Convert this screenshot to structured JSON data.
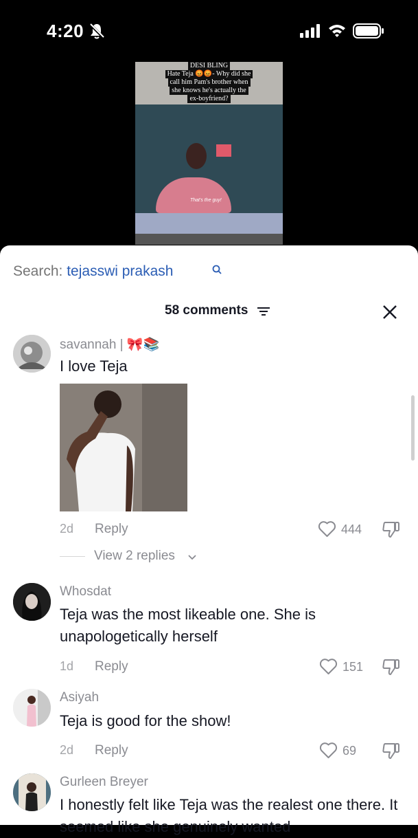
{
  "status": {
    "time": "4:20"
  },
  "video": {
    "caption_lines": [
      "DESI BLING",
      "Hate Teja 😡😡- Why did she",
      "call him Pam's brother when",
      "she knows he's actually the",
      "ex-boyfriend?"
    ],
    "subtitle": "That's the guy!"
  },
  "search": {
    "label": "Search: ",
    "query": "tejasswi prakash"
  },
  "header": {
    "comments_count": "58 comments"
  },
  "comments": [
    {
      "username": "savannah | 🎀📚",
      "text": "I love Teja",
      "time": "2d",
      "reply": "Reply",
      "likes": "444",
      "view_replies": "View 2 replies"
    },
    {
      "username": "Whosdat",
      "text": "Teja was the most likeable one. She is unapologetically herself",
      "time": "1d",
      "reply": "Reply",
      "likes": "151"
    },
    {
      "username": "Asiyah",
      "text": "Teja is good for the show!",
      "time": "2d",
      "reply": "Reply",
      "likes": "69"
    },
    {
      "username": "Gurleen Breyer",
      "text": "I honestly felt like Teja was the realest one there. It seemed like she genuinely wanted"
    }
  ],
  "colors": {
    "accent_link": "#2b5db4",
    "muted": "#8a8b91",
    "text": "#161823"
  }
}
